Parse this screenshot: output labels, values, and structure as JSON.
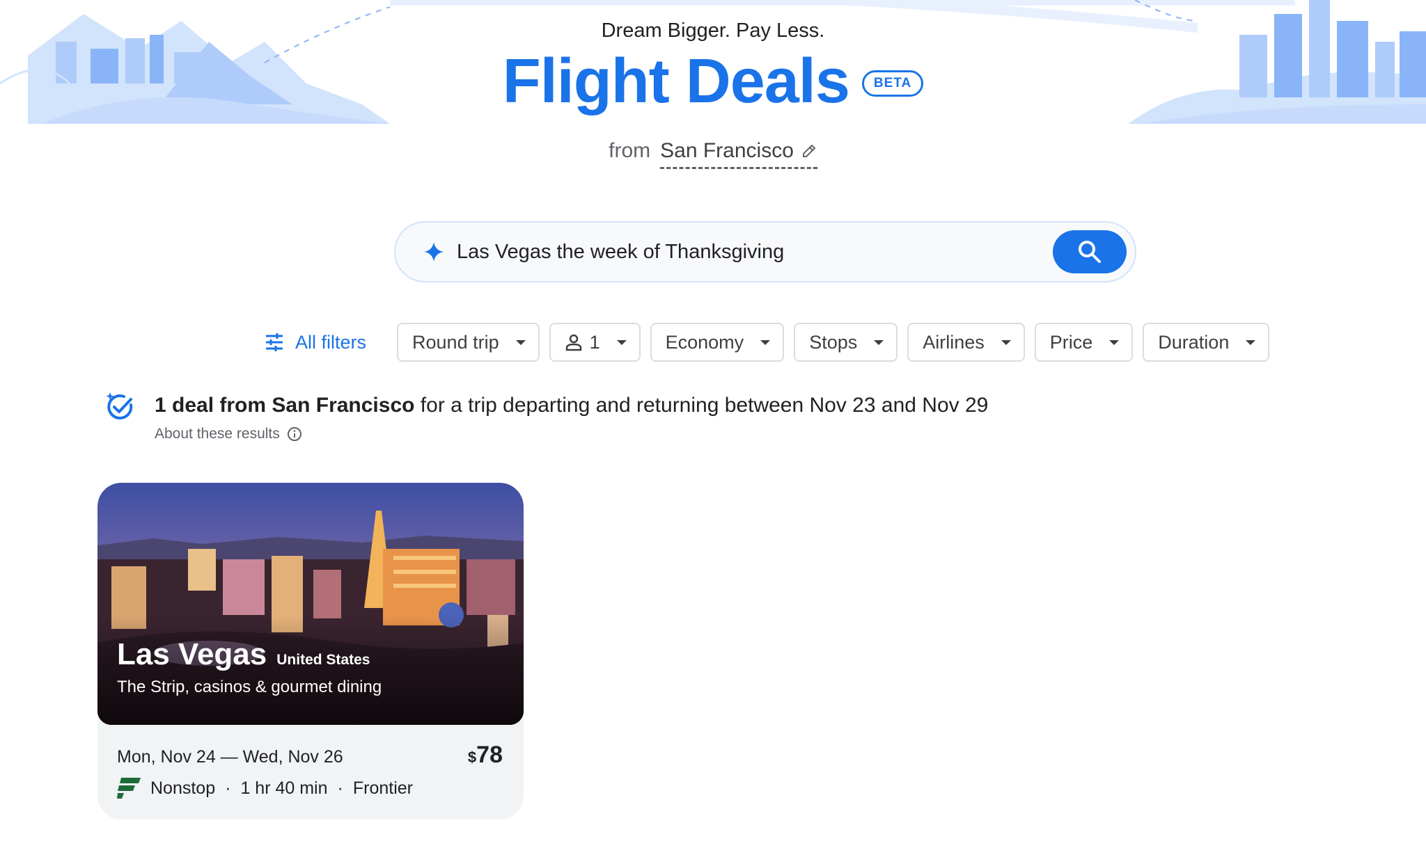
{
  "header": {
    "tagline": "Dream Bigger. Pay Less.",
    "title": "Flight Deals",
    "badge": "BETA",
    "from_label": "from",
    "origin": "San Francisco"
  },
  "search": {
    "value": "Las Vegas the week of Thanksgiving"
  },
  "filters": {
    "all_filters": "All filters",
    "chips": [
      "Round trip",
      "1",
      "Economy",
      "Stops",
      "Airlines",
      "Price",
      "Duration"
    ]
  },
  "summary": {
    "bold": "1 deal from San Francisco",
    "rest": " for a trip departing and returning between Nov 23 and Nov 29",
    "about": "About these results"
  },
  "deal": {
    "city": "Las Vegas",
    "country": "United States",
    "description": "The Strip, casinos & gourmet dining",
    "dates": "Mon, Nov 24 — Wed, Nov 26",
    "currency": "$",
    "price": "78",
    "stops": "Nonstop",
    "duration": "1 hr 40 min",
    "airline": "Frontier"
  },
  "colors": {
    "accent": "#1a73e8",
    "card_bg": "#f1f3f4",
    "airline_logo": "#1e6b3a"
  }
}
